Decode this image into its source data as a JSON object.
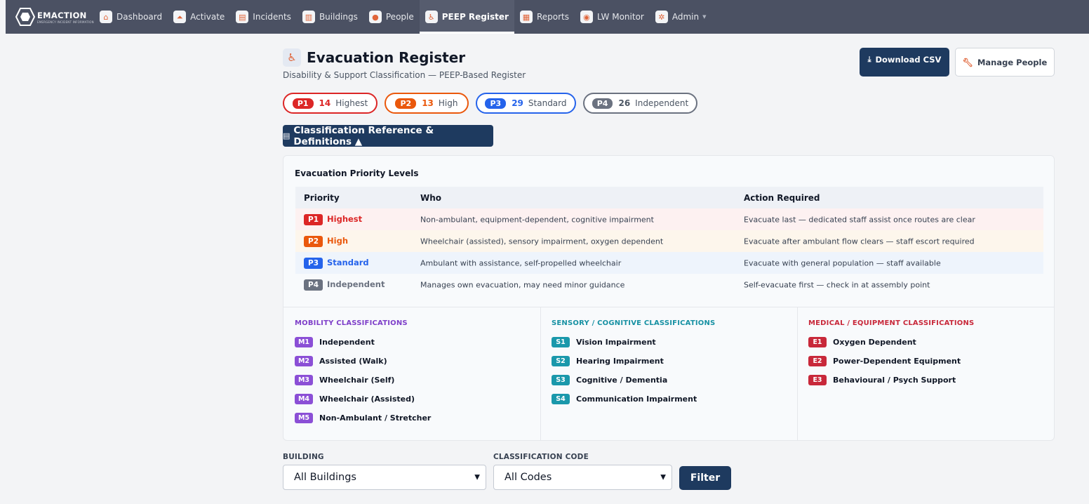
{
  "brand": {
    "name": "EMACTION",
    "tagline": "EMERGENCY INCIDENT INFORMATION"
  },
  "nav": [
    {
      "label": "Dashboard",
      "icon": "home-icon"
    },
    {
      "label": "Activate",
      "icon": "alarm-icon"
    },
    {
      "label": "Incidents",
      "icon": "clipboard-icon"
    },
    {
      "label": "Buildings",
      "icon": "building-icon"
    },
    {
      "label": "People",
      "icon": "person-icon"
    },
    {
      "label": "PEEP Register",
      "icon": "wheelchair-icon",
      "active": true
    },
    {
      "label": "Reports",
      "icon": "chart-icon"
    },
    {
      "label": "LW Monitor",
      "icon": "signal-icon"
    },
    {
      "label": "Admin",
      "icon": "gear-icon",
      "dropdown": true
    }
  ],
  "header": {
    "title": "Evacuation Register",
    "subtitle": "Disability & Support Classification — PEEP-Based Register",
    "download_label": "Download CSV",
    "manage_label": "Manage People"
  },
  "summary": [
    {
      "code": "P1",
      "count": "14",
      "label": "Highest",
      "color": "#dc2626"
    },
    {
      "code": "P2",
      "count": "13",
      "label": "High",
      "color": "#ea580c"
    },
    {
      "code": "P3",
      "count": "29",
      "label": "Standard",
      "color": "#2563eb"
    },
    {
      "code": "P4",
      "count": "26",
      "label": "Independent",
      "color": "#6b7280"
    }
  ],
  "toggle_label": "Classification Reference & Definitions ▲",
  "priority_levels": {
    "title": "Evacuation Priority Levels",
    "headers": {
      "priority": "Priority",
      "who": "Who",
      "action": "Action Required"
    },
    "rows": [
      {
        "code": "P1",
        "label": "Highest",
        "who": "Non-ambulant, equipment-dependent, cognitive impairment",
        "action": "Evacuate last — dedicated staff assist once routes are clear",
        "color": "#dc2626",
        "bg": "#fdf1f1"
      },
      {
        "code": "P2",
        "label": "High",
        "who": "Wheelchair (assisted), sensory impairment, oxygen dependent",
        "action": "Evacuate after ambulant flow clears — staff escort required",
        "color": "#ea580c",
        "bg": "#fdf6ec"
      },
      {
        "code": "P3",
        "label": "Standard",
        "who": "Ambulant with assistance, self-propelled wheelchair",
        "action": "Evacuate with general population — staff available",
        "color": "#2563eb",
        "bg": "#eef4fc"
      },
      {
        "code": "P4",
        "label": "Independent",
        "who": "Manages own evacuation, may need minor guidance",
        "action": "Self-evacuate first — check in at assembly point",
        "color": "#6b7280",
        "bg": "#f8fafc"
      }
    ]
  },
  "classifications": [
    {
      "heading": "MOBILITY CLASSIFICATIONS",
      "color": "#7e3fc9",
      "items": [
        {
          "code": "M1",
          "label": "Independent"
        },
        {
          "code": "M2",
          "label": "Assisted (Walk)"
        },
        {
          "code": "M3",
          "label": "Wheelchair (Self)"
        },
        {
          "code": "M4",
          "label": "Wheelchair (Assisted)"
        },
        {
          "code": "M5",
          "label": "Non-Ambulant / Stretcher"
        }
      ]
    },
    {
      "heading": "SENSORY / COGNITIVE CLASSIFICATIONS",
      "color": "#1791a3",
      "items": [
        {
          "code": "S1",
          "label": "Vision Impairment"
        },
        {
          "code": "S2",
          "label": "Hearing Impairment"
        },
        {
          "code": "S3",
          "label": "Cognitive / Dementia"
        },
        {
          "code": "S4",
          "label": "Communication Impairment"
        }
      ]
    },
    {
      "heading": "MEDICAL / EQUIPMENT CLASSIFICATIONS",
      "color": "#c8283a",
      "items": [
        {
          "code": "E1",
          "label": "Oxygen Dependent"
        },
        {
          "code": "E2",
          "label": "Power-Dependent Equipment"
        },
        {
          "code": "E3",
          "label": "Behavioural / Psych Support"
        }
      ]
    }
  ],
  "filters": {
    "building_label": "BUILDING",
    "building_value": "All Buildings",
    "code_label": "CLASSIFICATION CODE",
    "code_value": "All Codes",
    "filter_button": "Filter"
  }
}
